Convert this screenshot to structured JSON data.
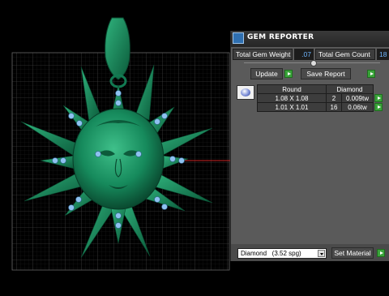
{
  "window": {
    "title": "GEM REPORTER"
  },
  "totals": {
    "weight_label": "Total Gem Weight",
    "weight_value": ".07",
    "count_label": "Total Gem Count",
    "count_value": "18"
  },
  "buttons": {
    "update": "Update",
    "save_report": "Save Report",
    "set_material": "Set Material"
  },
  "table": {
    "headers": [
      "Round",
      "",
      "Diamond"
    ],
    "rows": [
      {
        "size": "1.08 X 1.08",
        "count": "2",
        "weight": "0.009tw"
      },
      {
        "size": "1.01 X 1.01",
        "count": "16",
        "weight": "0.06tw"
      }
    ]
  },
  "material": {
    "selected": "Diamond   (3.52 spg)"
  },
  "colors": {
    "model": "#1a8a60",
    "arrow_button": "#3aa43a",
    "axis": "#cc2222",
    "gem": "#8ec1f0"
  }
}
